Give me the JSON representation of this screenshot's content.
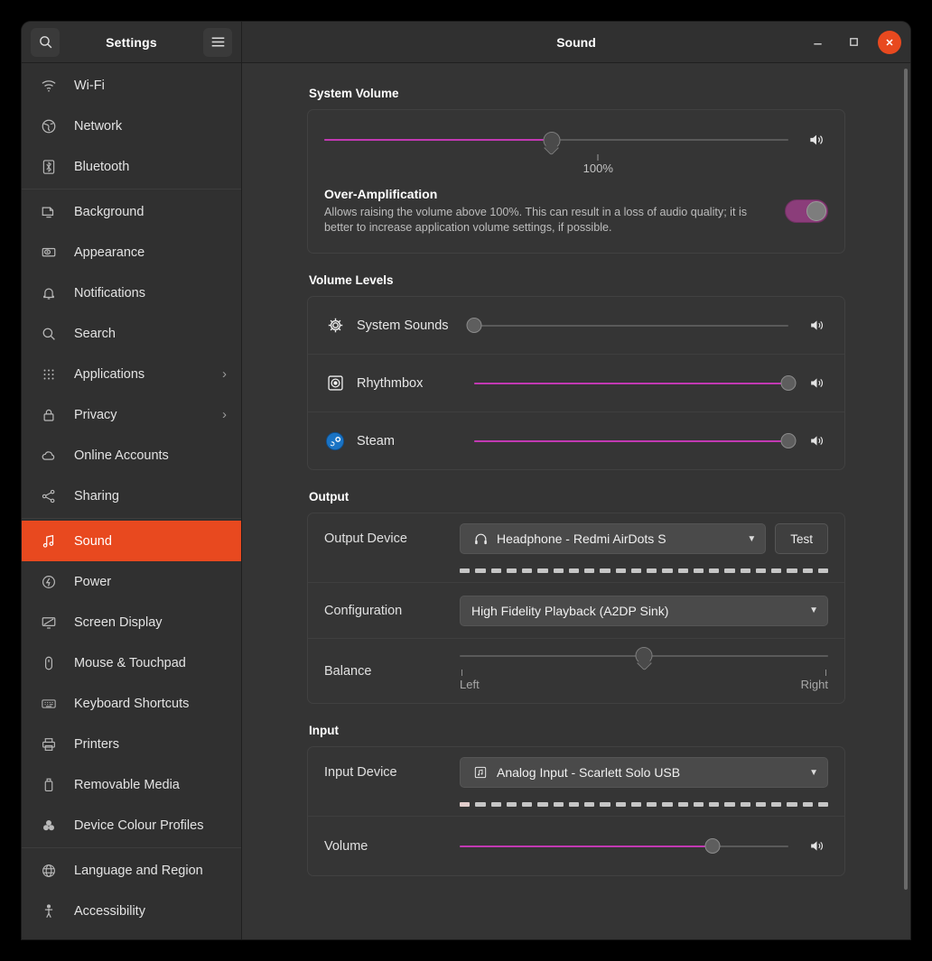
{
  "header": {
    "app_title": "Settings",
    "window_title": "Sound",
    "search_icon": "search-icon",
    "menu_icon": "hamburger-menu-icon",
    "minimize_label": "–",
    "maximize_label": "□",
    "close_label": "✕"
  },
  "colors": {
    "accent": "#e8491f",
    "slider_fill": "#c239b3",
    "toggle_on": "#8b3d7a",
    "window_bg": "#2d2d2d",
    "sidebar_bg": "#303030",
    "main_bg": "#343434"
  },
  "sidebar": {
    "groups": [
      {
        "items": [
          {
            "label": "Wi-Fi",
            "icon": "wifi-icon",
            "chevron": "",
            "active": false
          },
          {
            "label": "Network",
            "icon": "network-globe-icon",
            "chevron": "",
            "active": false
          },
          {
            "label": "Bluetooth",
            "icon": "bluetooth-icon",
            "chevron": "",
            "active": false
          }
        ]
      },
      {
        "items": [
          {
            "label": "Background",
            "icon": "background-icon",
            "chevron": "",
            "active": false
          },
          {
            "label": "Appearance",
            "icon": "appearance-icon",
            "chevron": "",
            "active": false
          },
          {
            "label": "Notifications",
            "icon": "bell-icon",
            "chevron": "",
            "active": false
          },
          {
            "label": "Search",
            "icon": "search-icon",
            "chevron": "",
            "active": false
          },
          {
            "label": "Applications",
            "icon": "grid-apps-icon",
            "chevron": "›",
            "active": false
          },
          {
            "label": "Privacy",
            "icon": "lock-icon",
            "chevron": "›",
            "active": false
          },
          {
            "label": "Online Accounts",
            "icon": "cloud-icon",
            "chevron": "",
            "active": false
          },
          {
            "label": "Sharing",
            "icon": "share-nodes-icon",
            "chevron": "",
            "active": false
          }
        ]
      },
      {
        "items": [
          {
            "label": "Sound",
            "icon": "sound-note-icon",
            "chevron": "",
            "active": true
          },
          {
            "label": "Power",
            "icon": "power-icon",
            "chevron": "",
            "active": false
          },
          {
            "label": "Screen Display",
            "icon": "display-icon",
            "chevron": "",
            "active": false
          },
          {
            "label": "Mouse & Touchpad",
            "icon": "mouse-icon",
            "chevron": "",
            "active": false
          },
          {
            "label": "Keyboard Shortcuts",
            "icon": "keyboard-icon",
            "chevron": "",
            "active": false
          },
          {
            "label": "Printers",
            "icon": "printer-icon",
            "chevron": "",
            "active": false
          },
          {
            "label": "Removable Media",
            "icon": "usb-drive-icon",
            "chevron": "",
            "active": false
          },
          {
            "label": "Device Colour Profiles",
            "icon": "colour-profile-icon",
            "chevron": "",
            "active": false
          }
        ]
      },
      {
        "items": [
          {
            "label": "Language and Region",
            "icon": "globe-icon",
            "chevron": "",
            "active": false
          },
          {
            "label": "Accessibility",
            "icon": "accessibility-icon",
            "chevron": "",
            "active": false
          }
        ]
      }
    ]
  },
  "main": {
    "system_volume": {
      "title": "System Volume",
      "slider": {
        "value_percent": 49,
        "tick_label": "100%",
        "tick_position_percent": 59
      },
      "speaker_icon": "speaker-volume-icon",
      "over_amplification": {
        "title": "Over-Amplification",
        "description": "Allows raising the volume above 100%. This can result in a loss of audio quality; it is better to increase application volume settings, if possible.",
        "enabled": true,
        "state_label": "on"
      }
    },
    "volume_levels": {
      "title": "Volume Levels",
      "apps": [
        {
          "name": "System Sounds",
          "icon": "system-sounds-gear-icon",
          "value_percent": 0,
          "speaker_icon": "speaker-volume-icon"
        },
        {
          "name": "Rhythmbox",
          "icon": "rhythmbox-icon",
          "value_percent": 100,
          "speaker_icon": "speaker-volume-icon"
        },
        {
          "name": "Steam",
          "icon": "steam-icon",
          "value_percent": 100,
          "speaker_icon": "speaker-volume-icon"
        }
      ]
    },
    "output": {
      "title": "Output",
      "device_label": "Output Device",
      "device_value": "Headphone - Redmi AirDots S",
      "device_icon": "headphone-icon",
      "test_label": "Test",
      "level_segments": 24,
      "level_lit": 0,
      "configuration_label": "Configuration",
      "configuration_value": "High Fidelity Playback (A2DP Sink)",
      "balance_label": "Balance",
      "balance_value_percent": 50,
      "balance_left_label": "Left",
      "balance_right_label": "Right",
      "dropdown_arrow_icon": "chevron-down-icon"
    },
    "input": {
      "title": "Input",
      "device_label": "Input Device",
      "device_value": "Analog Input - Scarlett Solo USB",
      "device_icon": "audio-card-icon",
      "level_segments": 24,
      "level_lit": 1,
      "volume_label": "Volume",
      "volume_value_percent": 77,
      "speaker_icon": "speaker-volume-icon",
      "dropdown_arrow_icon": "chevron-down-icon"
    }
  }
}
